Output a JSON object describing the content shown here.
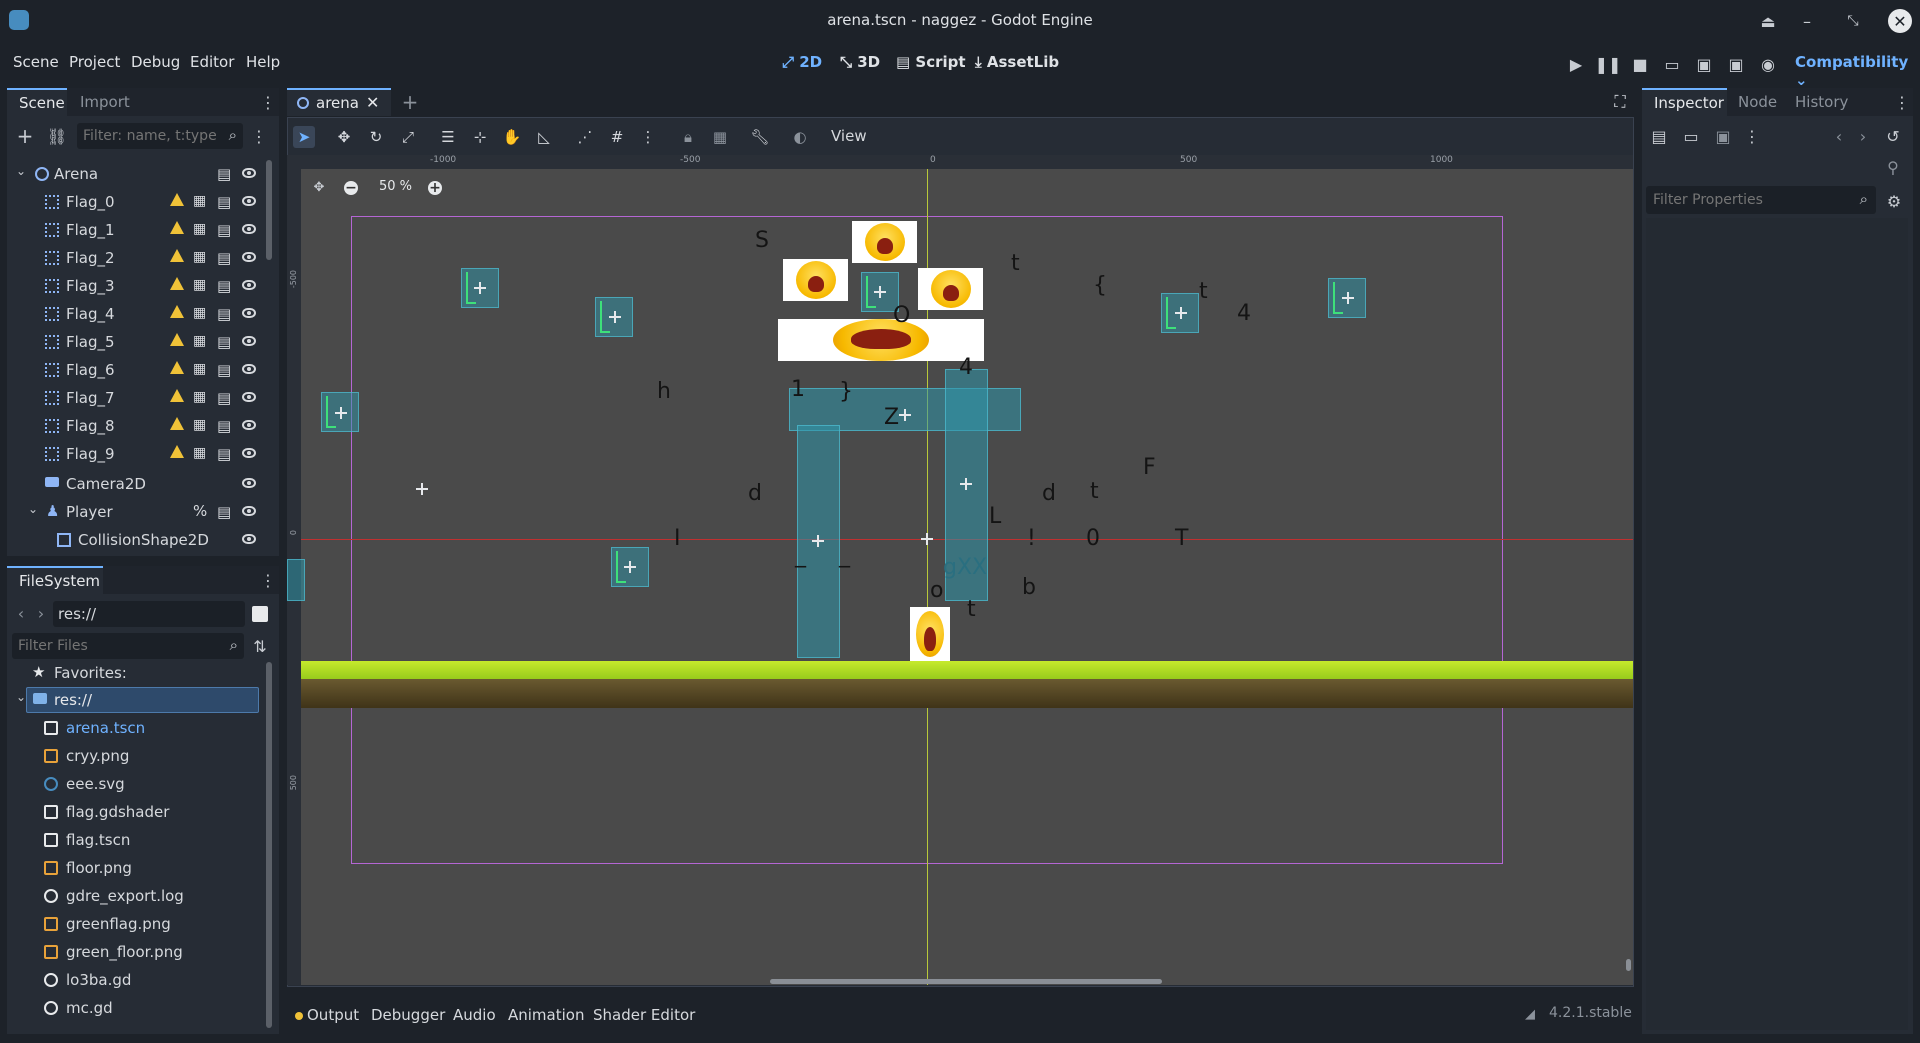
{
  "window": {
    "title": "arena.tscn - naggez - Godot Engine"
  },
  "menu": [
    "Scene",
    "Project",
    "Debug",
    "Editor",
    "Help"
  ],
  "workspaces": {
    "2d": "2D",
    "3d": "3D",
    "script": "Script",
    "assetlib": "AssetLib"
  },
  "renderer": "Compatibility",
  "scene_dock": {
    "tabs": [
      "Scene",
      "Import"
    ],
    "filter_placeholder": "Filter: name, t:type,",
    "tree": [
      {
        "label": "Arena",
        "icon": "node2d-icon"
      },
      {
        "label": "Flag_0",
        "icon": "area2d-icon"
      },
      {
        "label": "Flag_1",
        "icon": "area2d-icon"
      },
      {
        "label": "Flag_2",
        "icon": "area2d-icon"
      },
      {
        "label": "Flag_3",
        "icon": "area2d-icon"
      },
      {
        "label": "Flag_4",
        "icon": "area2d-icon"
      },
      {
        "label": "Flag_5",
        "icon": "area2d-icon"
      },
      {
        "label": "Flag_6",
        "icon": "area2d-icon"
      },
      {
        "label": "Flag_7",
        "icon": "area2d-icon"
      },
      {
        "label": "Flag_8",
        "icon": "area2d-icon"
      },
      {
        "label": "Flag_9",
        "icon": "area2d-icon"
      },
      {
        "label": "Camera2D",
        "icon": "camera-icon"
      },
      {
        "label": "Player",
        "icon": "character-icon",
        "badge": "%"
      },
      {
        "label": "CollisionShape2D",
        "icon": "collision-shape-icon"
      }
    ]
  },
  "filesystem_dock": {
    "tab": "FileSystem",
    "path": "res://",
    "filter_placeholder": "Filter Files",
    "favorites": "Favorites:",
    "root": "res://",
    "files": [
      {
        "name": "arena.tscn",
        "icon": "scene-icon",
        "color": "#6fb2ff"
      },
      {
        "name": "cryy.png",
        "icon": "image-icon"
      },
      {
        "name": "eee.svg",
        "icon": "svg-icon"
      },
      {
        "name": "flag.gdshader",
        "icon": "shader-icon"
      },
      {
        "name": "flag.tscn",
        "icon": "scene-icon"
      },
      {
        "name": "floor.png",
        "icon": "image-icon"
      },
      {
        "name": "gdre_export.log",
        "icon": "gear-icon"
      },
      {
        "name": "greenflag.png",
        "icon": "image-icon"
      },
      {
        "name": "green_floor.png",
        "icon": "image-icon"
      },
      {
        "name": "lo3ba.gd",
        "icon": "gear-icon"
      },
      {
        "name": "mc.gd",
        "icon": "gear-icon"
      }
    ]
  },
  "editor_tab": {
    "label": "arena"
  },
  "viewport": {
    "view_menu": "View",
    "zoom": "50 %",
    "ruler_labels": [
      "-1000",
      "-500",
      "0",
      "500",
      "1000"
    ],
    "ruler_v_labels": [
      "-500",
      "0",
      "500"
    ],
    "letters": [
      "S",
      "t",
      "{",
      "t",
      "4",
      "h",
      "1",
      "}",
      "4",
      "Z",
      "O",
      "d",
      "d",
      "t",
      "F",
      "L",
      "I",
      "!",
      "0",
      "T",
      "_",
      "_",
      "gXX",
      "o",
      "b",
      "t"
    ]
  },
  "inspector_dock": {
    "tabs": [
      "Inspector",
      "Node",
      "History"
    ],
    "filter_placeholder": "Filter Properties"
  },
  "bottom_panel": {
    "tabs": [
      "Output",
      "Debugger",
      "Audio",
      "Animation",
      "Shader Editor"
    ],
    "version": "4.2.1.stable"
  },
  "colors": {
    "accent": "#6fb2ff",
    "warning": "#f0c238",
    "selection": "#2e4a6b"
  }
}
